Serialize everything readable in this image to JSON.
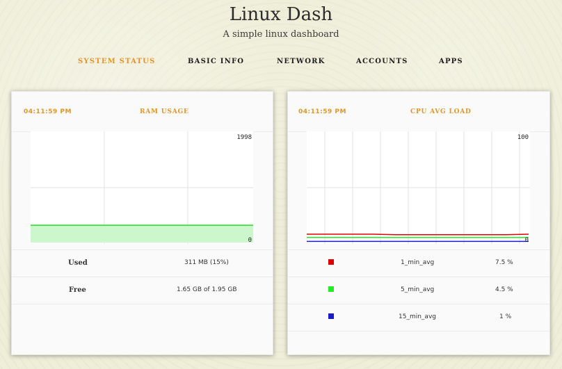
{
  "header": {
    "title": "Linux Dash",
    "subtitle": "A simple linux dashboard"
  },
  "nav": {
    "items": [
      {
        "label": "SYSTEM STATUS",
        "active": true
      },
      {
        "label": "BASIC INFO",
        "active": false
      },
      {
        "label": "NETWORK",
        "active": false
      },
      {
        "label": "ACCOUNTS",
        "active": false
      },
      {
        "label": "APPS",
        "active": false
      }
    ]
  },
  "colors": {
    "accent": "#e0962a",
    "ram_line": "#22dd22",
    "ram_fill": "#ccf7cc",
    "one_min": "#dd0000",
    "five_min": "#22ee22",
    "fifteen_min": "#1a1acc"
  },
  "ram_card": {
    "time": "04:11:59 PM",
    "title": "RAM USAGE",
    "rows": [
      {
        "label": "Used",
        "value": "311 MB (15%)"
      },
      {
        "label": "Free",
        "value": "1.65 GB of 1.95 GB"
      }
    ]
  },
  "cpu_card": {
    "time": "04:11:59 PM",
    "title": "CPU AVG LOAD",
    "rows": [
      {
        "name": "1_min_avg",
        "value": "7.5 %"
      },
      {
        "name": "5_min_avg",
        "value": "4.5 %"
      },
      {
        "name": "15_min_avg",
        "value": "1 %"
      }
    ]
  },
  "chart_data": [
    {
      "type": "area",
      "ylim": [
        0,
        1998
      ],
      "tick_labels": {
        "max": "1998",
        "min": "0"
      },
      "series": [
        {
          "values": [
            311,
            311,
            311,
            311,
            311,
            311,
            311,
            311
          ]
        }
      ]
    },
    {
      "type": "line",
      "ylim": [
        0,
        100
      ],
      "tick_labels": {
        "max": "100",
        "min": "0"
      },
      "series": [
        {
          "name": "1_min_avg",
          "values": [
            7.5,
            7.5,
            7.5,
            7.5,
            7.0,
            7.0,
            7.0,
            7.0,
            7.0,
            7.0,
            7.5
          ]
        },
        {
          "name": "5_min_avg",
          "values": [
            4.5,
            4.5,
            4.5,
            4.5,
            4.5,
            4.5,
            4.5,
            4.5,
            4.5,
            4.5,
            4.5
          ]
        },
        {
          "name": "15_min_avg",
          "values": [
            1,
            1,
            1,
            1,
            1,
            1,
            1,
            1,
            1,
            1,
            1
          ]
        }
      ]
    }
  ]
}
